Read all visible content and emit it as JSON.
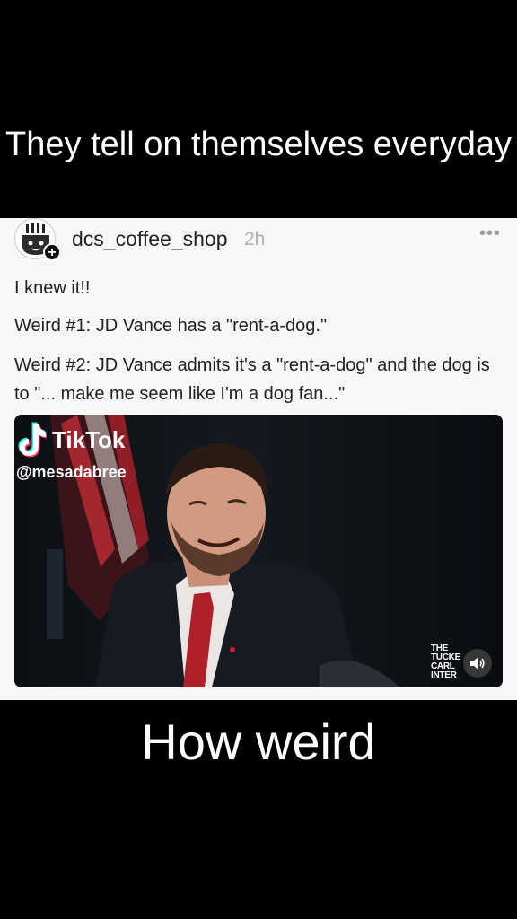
{
  "overlay": {
    "top_caption": "They tell on themselves everyday",
    "bottom_caption": "How weird"
  },
  "post": {
    "username": "dcs_coffee_shop",
    "time": "2h",
    "more_label": "•••",
    "lines": [
      "I knew it!!",
      "Weird #1: JD Vance has a \"rent-a-dog.\"",
      "Weird #2: JD Vance admits it's a \"rent-a-dog\" and the dog is to \"... make me seem like I'm a dog fan...\""
    ],
    "avatar_icon": "coffee-cup-avatar-icon",
    "follow_icon": "plus-icon"
  },
  "video": {
    "watermark_brand": "TikTok",
    "watermark_handle": "@mesadabree",
    "channel_mark_lines": [
      "THE",
      "TUCKE",
      "CARL",
      "INTER"
    ],
    "volume_icon": "speaker-icon"
  },
  "colors": {
    "background": "#000000",
    "card": "#f7f7f7",
    "text": "#222222",
    "tie": "#b0202a",
    "flag_red": "#a8202a"
  }
}
